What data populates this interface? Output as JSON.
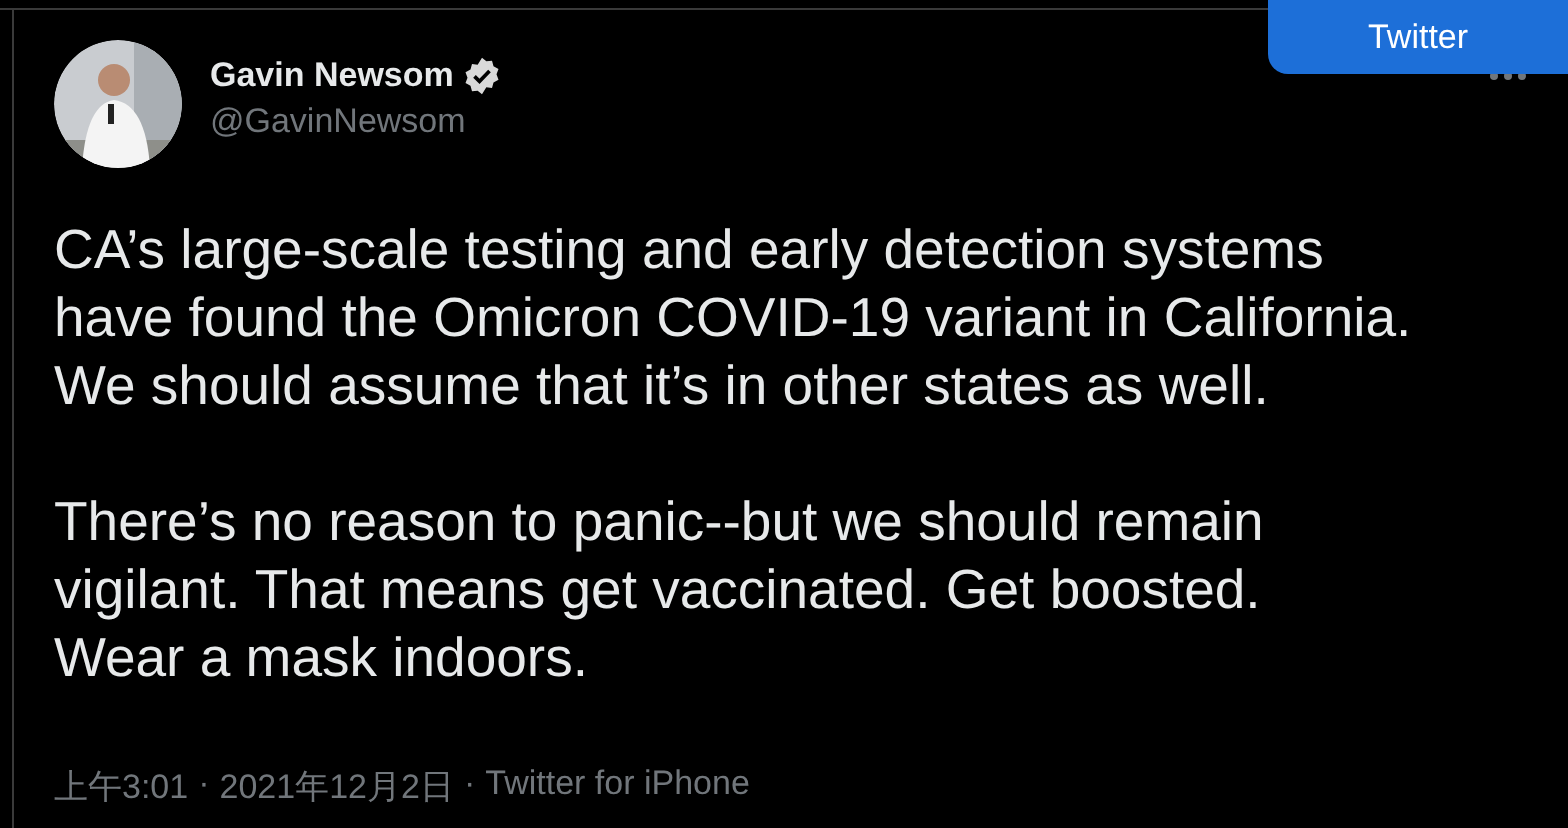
{
  "overlay_button": {
    "label": "Twitter"
  },
  "author": {
    "name": "Gavin Newsom",
    "verified": true,
    "handle": "@GavinNewsom"
  },
  "paragraphs": [
    [
      "CA’s large-scale testing and early detection systems",
      "have found the Omicron COVID-19 variant in California.",
      "We should assume that it’s in other states as well."
    ],
    [
      "There’s no reason to panic--but we should remain",
      "vigilant. That means get vaccinated. Get boosted.",
      "Wear a mask indoors."
    ]
  ],
  "footer": {
    "time": "上午3:01",
    "separator_1": "·",
    "date": "2021年12月2日",
    "separator_2": "·",
    "source": "Twitter for iPhone"
  }
}
